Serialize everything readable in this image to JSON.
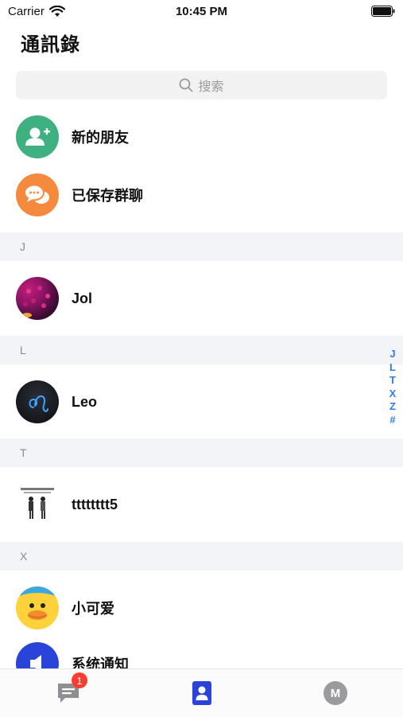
{
  "status_bar": {
    "carrier": "Carrier",
    "time": "10:45 PM"
  },
  "header": {
    "title": "通訊錄"
  },
  "search": {
    "placeholder": "搜索"
  },
  "shortcuts": [
    {
      "label": "新的朋友",
      "icon": "add-user-icon",
      "color": "#3fb07f"
    },
    {
      "label": "已保存群聊",
      "icon": "chat-bubbles-icon",
      "color": "#f5893e"
    }
  ],
  "sections": [
    {
      "letter": "J",
      "contacts": [
        {
          "name": "Jol"
        }
      ]
    },
    {
      "letter": "L",
      "contacts": [
        {
          "name": "Leo"
        }
      ]
    },
    {
      "letter": "T",
      "contacts": [
        {
          "name": "tttttttt5"
        }
      ]
    },
    {
      "letter": "X",
      "contacts": [
        {
          "name": "小可爱"
        },
        {
          "name": "系统通知"
        }
      ]
    }
  ],
  "index_bar": [
    "J",
    "L",
    "T",
    "X",
    "Z",
    "#"
  ],
  "tab_bar": {
    "messages_badge": "1",
    "profile_initial": "M",
    "active_color": "#2a43d8"
  }
}
